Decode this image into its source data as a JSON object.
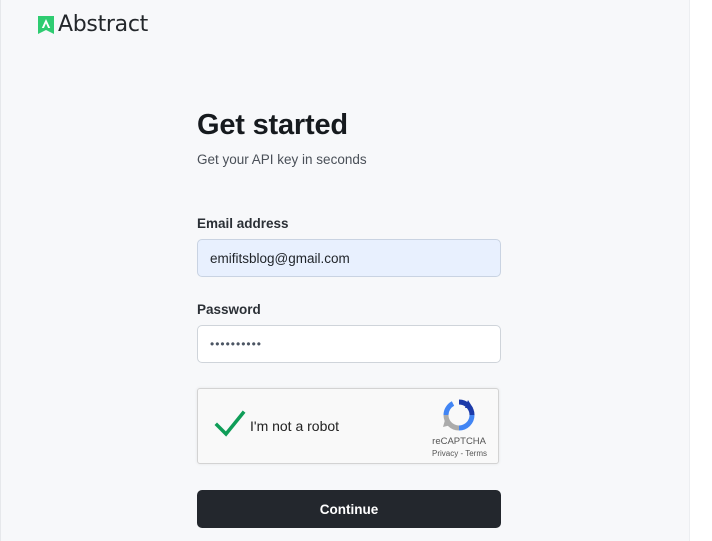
{
  "brand": {
    "name": "Abstract",
    "accent_color": "#2ecc71",
    "icon": "abstract-logo-icon"
  },
  "form": {
    "title": "Get started",
    "subtitle": "Get your API key in seconds",
    "email": {
      "label": "Email address",
      "value": "emifitsblog@gmail.com"
    },
    "password": {
      "label": "Password",
      "masked_value": "••••••••••"
    },
    "captcha": {
      "label": "I'm not a robot",
      "checked": true,
      "brand": "reCAPTCHA",
      "privacy": "Privacy",
      "separator": " - ",
      "terms": "Terms",
      "check_color": "#0f9d58"
    },
    "submit_label": "Continue"
  }
}
